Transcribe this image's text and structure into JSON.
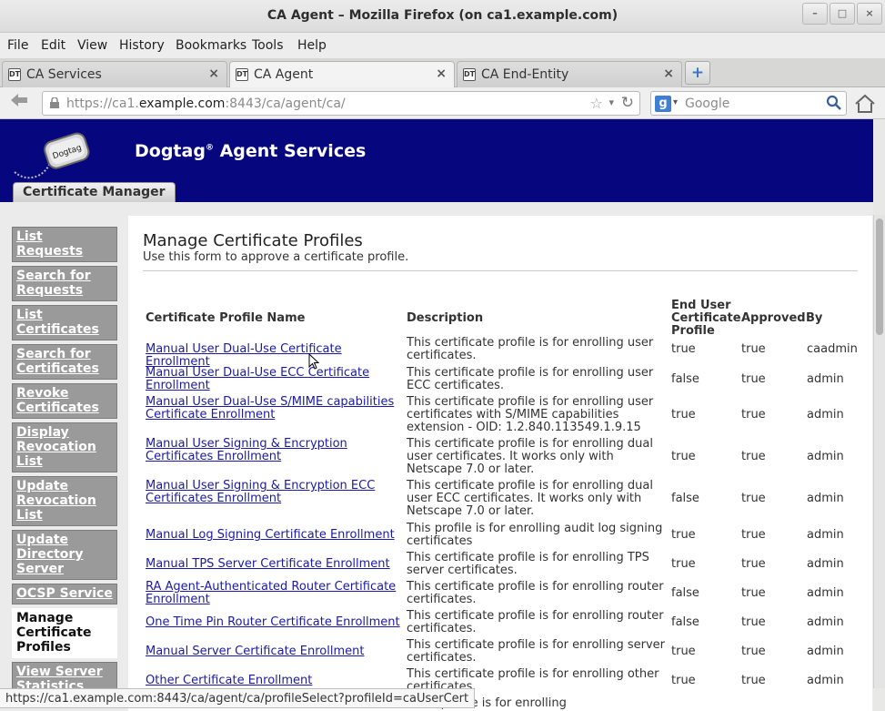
{
  "window": {
    "title": "CA Agent – Mozilla Firefox (on ca1.example.com)",
    "controls": [
      "–",
      "□",
      "×"
    ]
  },
  "menubar": [
    "File",
    "Edit",
    "View",
    "History",
    "Bookmarks",
    "Tools",
    "Help"
  ],
  "tabs": [
    {
      "label": "CA Services",
      "active": false
    },
    {
      "label": "CA Agent",
      "active": true
    },
    {
      "label": "CA End-Entity",
      "active": false
    }
  ],
  "tab_close_glyph": "×",
  "tab_favicon": "DT",
  "new_tab_glyph": "+",
  "navbar": {
    "url_host_prefix": "https://ca1.",
    "url_host_main": "example.com",
    "url_rest": ":8443/ca/agent/ca/",
    "search_placeholder": "Google",
    "search_engine_letter": "g"
  },
  "header": {
    "logo_text": "Dogtag",
    "brand": "Dogtag",
    "brand_sup": "®",
    "brand_suffix": "Agent Services",
    "tab": "Certificate Manager"
  },
  "sidebar": [
    {
      "label": "List Requests",
      "current": false
    },
    {
      "label": "Search for Requests",
      "current": false
    },
    {
      "label": "List Certificates",
      "current": false
    },
    {
      "label": "Search for Certificates",
      "current": false
    },
    {
      "label": "Revoke Certificates",
      "current": false
    },
    {
      "label": "Display Revocation List",
      "current": false
    },
    {
      "label": "Update Revocation List",
      "current": false
    },
    {
      "label": "Update Directory Server",
      "current": false
    },
    {
      "label": "OCSP Service",
      "current": false
    },
    {
      "label": "Manage Certificate Profiles",
      "current": true
    },
    {
      "label": "View Server Statistics",
      "current": false
    }
  ],
  "main": {
    "title": "Manage Certificate Profiles",
    "subtitle": "Use this form to approve a certificate profile.",
    "columns": {
      "name": "Certificate Profile Name",
      "description": "Description",
      "end_user": "End User Certificate Profile",
      "approved": "Approved",
      "by": "By"
    },
    "rows": [
      {
        "name": "Manual User Dual-Use Certificate Enrollment",
        "description": "This certificate profile is for enrolling user certificates.",
        "end_user": "true",
        "approved": "true",
        "by": "caadmin"
      },
      {
        "name": "Manual User Dual-Use ECC Certificate Enrollment",
        "description": "This certificate profile is for enrolling user ECC certificates.",
        "end_user": "false",
        "approved": "true",
        "by": "admin"
      },
      {
        "name": "Manual User Dual-Use S/MIME capabilities Certificate Enrollment",
        "description": "This certificate profile is for enrolling user certificates with S/MIME capabilities extension - OID: 1.2.840.113549.1.9.15",
        "end_user": "true",
        "approved": "true",
        "by": "admin"
      },
      {
        "name": "Manual User Signing & Encryption Certificates Enrollment",
        "description": "This certificate profile is for enrolling dual user certificates. It works only with Netscape 7.0 or later.",
        "end_user": "true",
        "approved": "true",
        "by": "admin"
      },
      {
        "name": "Manual User Signing & Encryption ECC Certificates Enrollment",
        "description": "This certificate profile is for enrolling dual user ECC certificates. It works only with Netscape 7.0 or later.",
        "end_user": "false",
        "approved": "true",
        "by": "admin"
      },
      {
        "name": "Manual Log Signing Certificate Enrollment",
        "description": "This profile is for enrolling audit log signing certificates",
        "end_user": "true",
        "approved": "true",
        "by": "admin"
      },
      {
        "name": "Manual TPS Server Certificate Enrollment",
        "description": "This certificate profile is for enrolling TPS server certificates.",
        "end_user": "true",
        "approved": "true",
        "by": "admin"
      },
      {
        "name": "RA Agent-Authenticated Router Certificate Enrollment",
        "description": "This certificate profile is for enrolling router certificates.",
        "end_user": "false",
        "approved": "true",
        "by": "admin"
      },
      {
        "name": "One Time Pin Router Certificate Enrollment",
        "description": "This certificate profile is for enrolling router certificates.",
        "end_user": "false",
        "approved": "true",
        "by": "admin"
      },
      {
        "name": "Manual Server Certificate Enrollment",
        "description": "This certificate profile is for enrolling server certificates.",
        "end_user": "true",
        "approved": "true",
        "by": "admin"
      },
      {
        "name": "Other Certificate Enrollment",
        "description": "This certificate profile is for enrolling other certificates.",
        "end_user": "true",
        "approved": "true",
        "by": "admin"
      }
    ],
    "partial_row_text": "...ate profile is for enrolling"
  },
  "status_bar": "https://ca1.example.com:8443/ca/agent/ca/profileSelect?profileId=caUserCert"
}
